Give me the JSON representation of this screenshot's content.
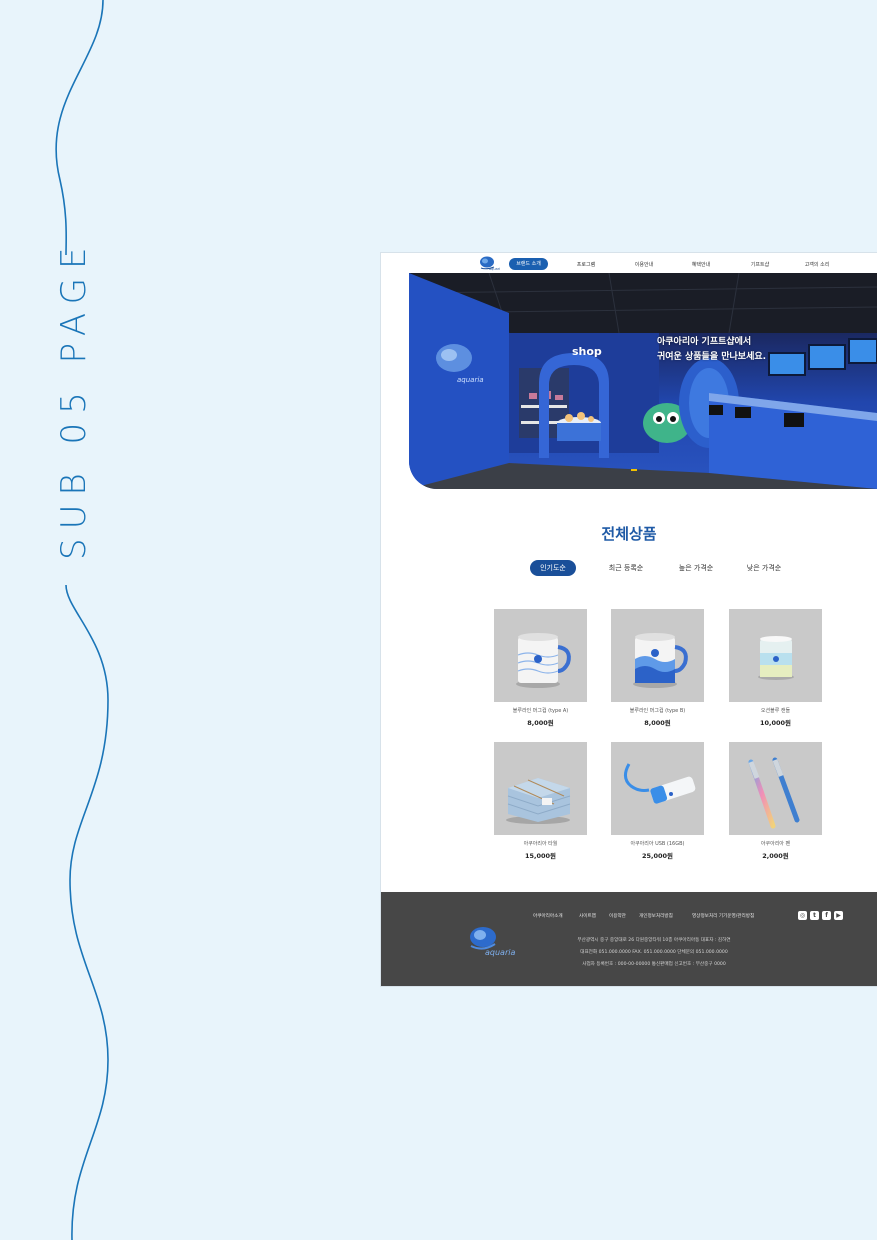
{
  "side_title": "SUB 05 PAGE",
  "colors": {
    "page_bg": "#e8f4fb",
    "accent": "#1a75b8",
    "nav_active": "#1a5fb0",
    "footer_bg": "#474747"
  },
  "nav": {
    "logo_text": "aquaria",
    "items": [
      {
        "label": "브랜드 소개",
        "active": true
      },
      {
        "label": "프로그램",
        "active": false
      },
      {
        "label": "이용안내",
        "active": false
      },
      {
        "label": "혜택안내",
        "active": false
      },
      {
        "label": "기프트샵",
        "active": false
      },
      {
        "label": "고객의 소리",
        "active": false
      }
    ]
  },
  "hero": {
    "line1": "아쿠아리아 기프트샵에서",
    "line2": "귀여운 상품들을 만나보세요.",
    "shop_sign": "shop",
    "wall_logo": "aquaria"
  },
  "section": {
    "title": "전체상품",
    "filters": [
      {
        "label": "인기도순",
        "active": true
      },
      {
        "label": "최근 등록순",
        "active": false
      },
      {
        "label": "높은 가격순",
        "active": false
      },
      {
        "label": "낮은 가격순",
        "active": false
      }
    ]
  },
  "products": [
    {
      "name": "블루라인 머그컵 (type A)",
      "price": "8,000원",
      "icon": "mug-icon"
    },
    {
      "name": "블루라인 머그컵 (type B)",
      "price": "8,000원",
      "icon": "mug-icon"
    },
    {
      "name": "오션블루 캔들",
      "price": "10,000원",
      "icon": "candle-icon"
    },
    {
      "name": "아쿠아리아 타월",
      "price": "15,000원",
      "icon": "towel-icon"
    },
    {
      "name": "아쿠아리아 USB (16GB)",
      "price": "25,000원",
      "icon": "usb-icon"
    },
    {
      "name": "아쿠아리아 펜",
      "price": "2,000원",
      "icon": "pen-icon"
    }
  ],
  "footer": {
    "links": [
      "아쿠아리아소개",
      "사이트맵",
      "이용약관",
      "개인정보처리방침",
      "영상정보처리 기기운영/관리방침"
    ],
    "logo_text": "aquaria",
    "info": [
      "부산광역시 중구 중앙대로 26 다원중앙타워 10층 아쿠아리아동 대표자 : 김하연",
      "대표전화 051.000.0000  FAX. 051.000.0000  단체문의 051.000.0000",
      "사업자 등록번호 : 000-00-00000 통신판매업 신고번호 : 부산중구 0000"
    ],
    "social": [
      "instagram-icon",
      "twitter-icon",
      "facebook-icon",
      "youtube-icon"
    ]
  }
}
